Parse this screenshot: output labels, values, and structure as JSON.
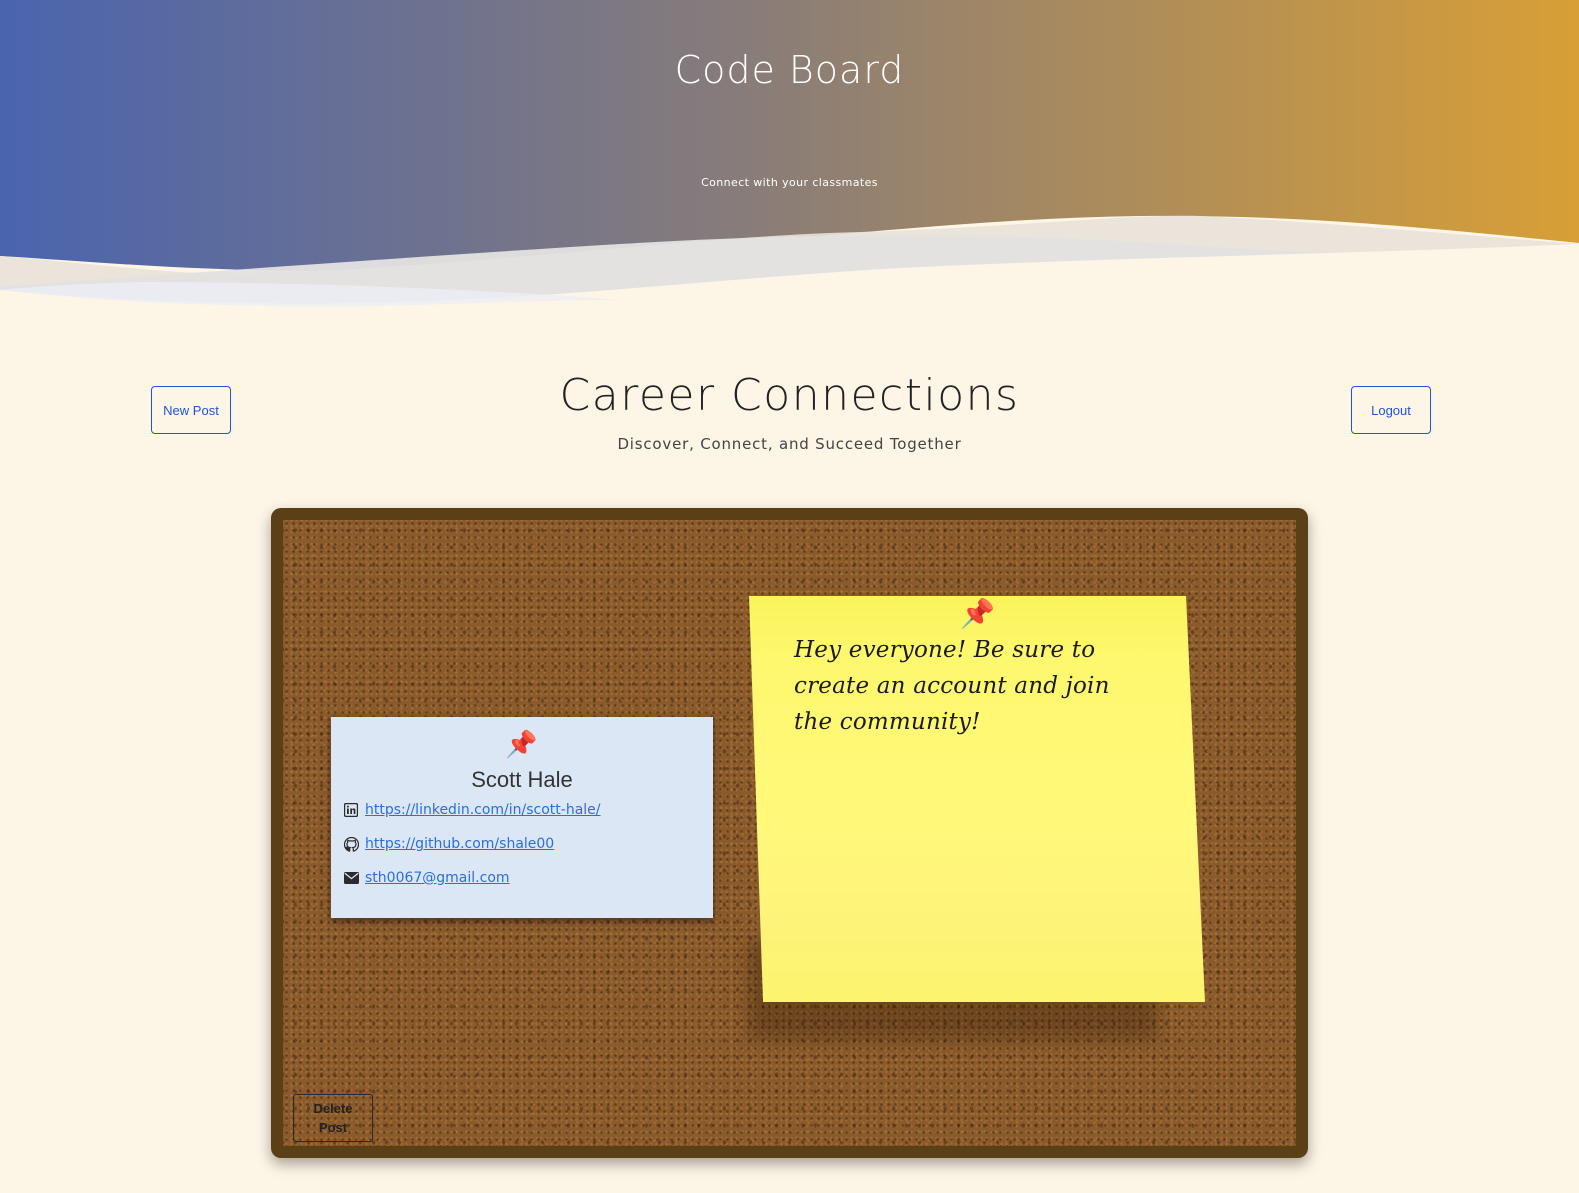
{
  "header": {
    "title": "Code Board",
    "subtitle": "Connect with your classmates"
  },
  "section": {
    "title": "Career Connections",
    "subtitle": "Discover, Connect, and Succeed Together",
    "new_post_label": "New Post",
    "logout_label": "Logout"
  },
  "board": {
    "card": {
      "pin_icon": "pushpin-icon",
      "name": "Scott Hale",
      "links": [
        {
          "icon": "linkedin-icon",
          "text": "https://linkedin.com/in/scott-hale/"
        },
        {
          "icon": "github-icon",
          "text": "https://github.com/shale00"
        },
        {
          "icon": "envelope-icon",
          "text": "sth0067@gmail.com"
        }
      ]
    },
    "note": {
      "pin_icon": "pushpin-icon",
      "text": "Hey everyone! Be sure to create an account and join the community!"
    },
    "delete_label": "Delete Post"
  },
  "colors": {
    "gradient_start": "#4a64ae",
    "gradient_end": "#d89f36",
    "page_background": "#fdf5e6",
    "button_accent": "#1a56db",
    "card_background": "#dce7f5",
    "note_background": "#fff97a",
    "board_frame": "#5b4017",
    "link_color": "#2a6fdb"
  }
}
